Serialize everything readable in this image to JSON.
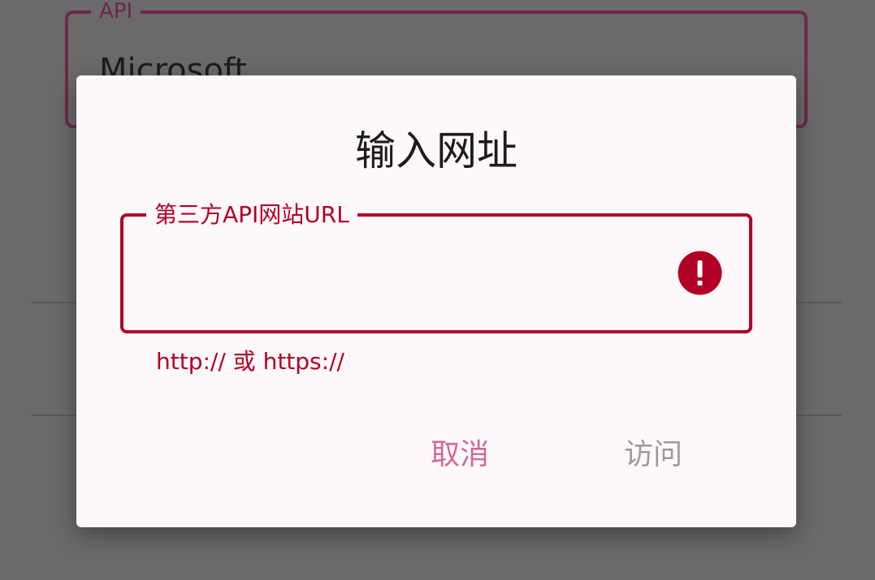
{
  "background": {
    "api_field": {
      "label": "API",
      "value": "Microsoft"
    }
  },
  "dialog": {
    "title": "输入网址",
    "url_field": {
      "label": "第三方API网站URL",
      "value": "",
      "helper_text": "http:// 或 https://",
      "error_icon": "error-icon"
    },
    "buttons": {
      "cancel_label": "取消",
      "visit_label": "访问"
    }
  },
  "colors": {
    "scrim": "#6b696a",
    "dialog_surface": "#fdf8fa",
    "error": "#b10025",
    "accent": "#d1699b",
    "disabled_text": "#9e9b9d",
    "background_field_outline": "#6a2a4a"
  }
}
